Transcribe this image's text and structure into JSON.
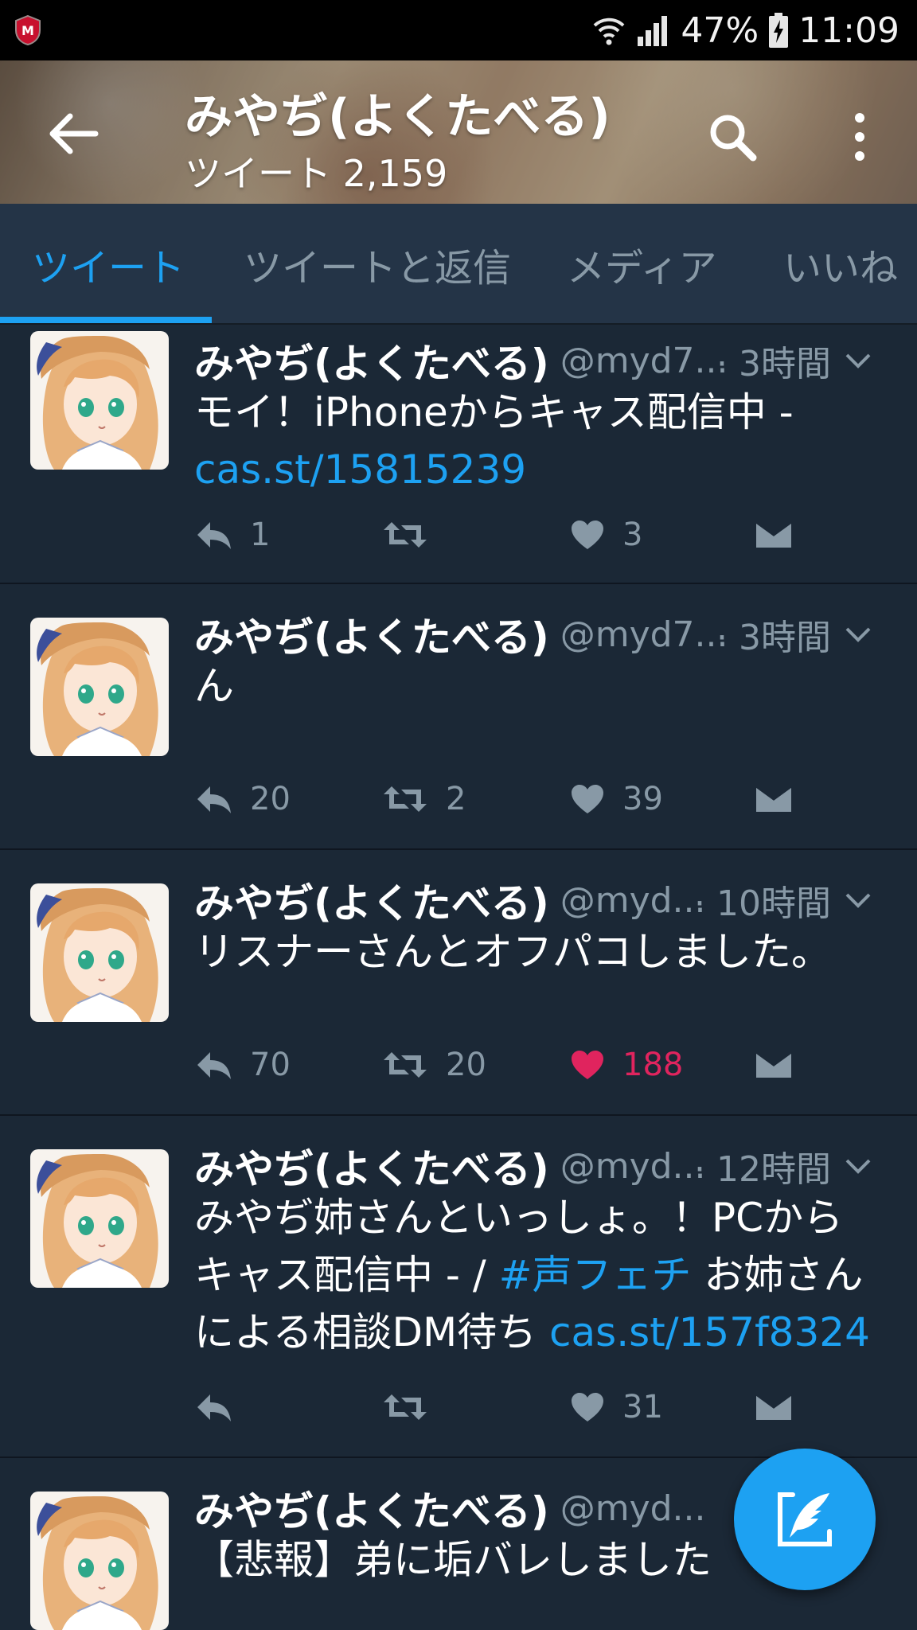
{
  "status_bar": {
    "battery": "47%",
    "time": "11:09",
    "app_icon": "mcafee-shield-icon"
  },
  "header": {
    "title": "みやぢ(よくたべる)",
    "tweet_count_label": "ツイート 2,159"
  },
  "tabs": [
    {
      "label": "ツイート",
      "active": true
    },
    {
      "label": "ツイートと返信",
      "active": false
    },
    {
      "label": "メディア",
      "active": false
    },
    {
      "label": "いいね",
      "active": false
    }
  ],
  "tweets": [
    {
      "name": "みやぢ(よくたべる)",
      "handle": "@myd7...",
      "time": "· 3時間",
      "text": "モイ！iPhoneからキャス配信中 -",
      "link": "cas.st/15815239",
      "replies": "1",
      "retweets": "",
      "likes": "3",
      "liked": false
    },
    {
      "name": "みやぢ(よくたべる)",
      "handle": "@myd7...",
      "time": "· 3時間",
      "text": "ん",
      "replies": "20",
      "retweets": "2",
      "likes": "39",
      "liked": false
    },
    {
      "name": "みやぢ(よくたべる)",
      "handle": "@myd...",
      "time": "· 10時間",
      "text": "リスナーさんとオフパコしました。",
      "replies": "70",
      "retweets": "20",
      "likes": "188",
      "liked": true
    },
    {
      "name": "みやぢ(よくたべる)",
      "handle": "@myd...",
      "time": "· 12時間",
      "line1": "みやぢ姉さんといっしょ。！PCから",
      "line2_pre": "キャス配信中 - /",
      "hashtag": "#声フェチ",
      "line2_post": "お姉さん",
      "line3_pre": "による相談DM待ち",
      "link": "cas.st/157f8324",
      "replies": "",
      "retweets": "",
      "likes": "31",
      "liked": false
    },
    {
      "name": "みやぢ(よくたべる)",
      "handle": "@myd...",
      "time": "· 1",
      "text": "【悲報】弟に垢バレしました"
    }
  ],
  "colors": {
    "accent": "#1da1f2",
    "like": "#e0245e",
    "background": "#1b2836",
    "tabbar": "#243447",
    "muted": "#8899a6"
  }
}
